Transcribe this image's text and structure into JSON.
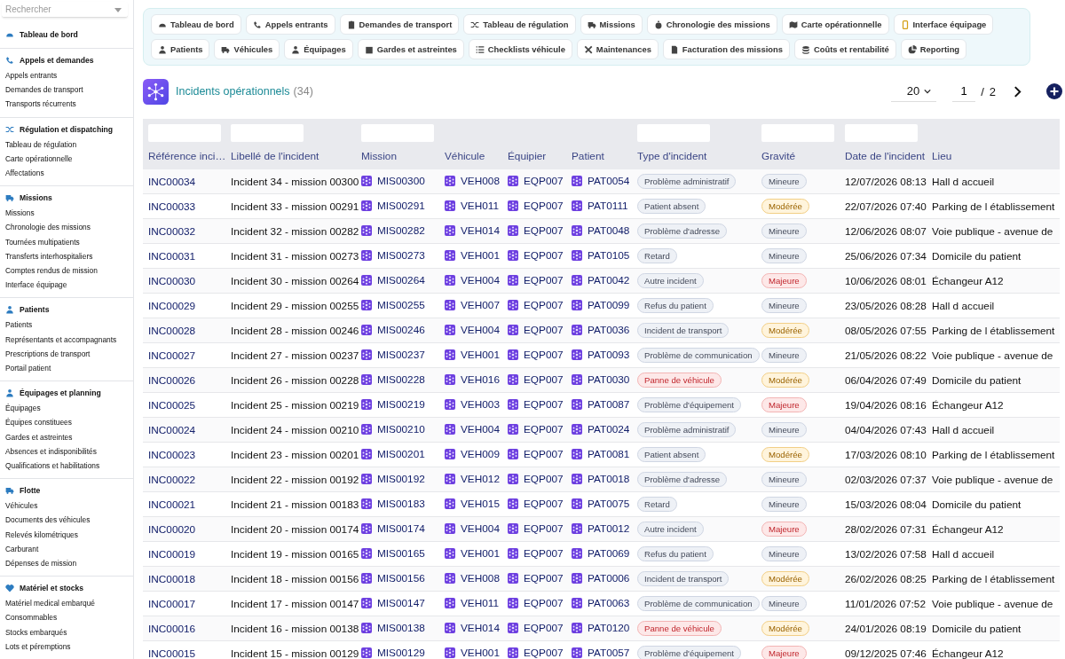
{
  "sidebar": {
    "search": {
      "placeholder": "Rechercher"
    },
    "sections": [
      {
        "title": "Tableau de bord"
      },
      {
        "title": "Appels et demandes",
        "items": [
          "Appels entrants",
          "Demandes de transport",
          "Transports récurrents"
        ]
      },
      {
        "title": "Régulation et dispatching",
        "items": [
          "Tableau de régulation",
          "Carte opérationnelle",
          "Affectations"
        ]
      },
      {
        "title": "Missions",
        "items": [
          "Missions",
          "Chronologie des missions",
          "Tournées multipatients",
          "Transferts interhospitaliers",
          "Comptes rendus de mission",
          "Interface équipage"
        ]
      },
      {
        "title": "Patients",
        "items": [
          "Patients",
          "Représentants et accompagnants",
          "Prescriptions de transport",
          "Portail patient"
        ]
      },
      {
        "title": "Équipages et planning",
        "items": [
          "Équipages",
          "Équipes constituees",
          "Gardes et astreintes",
          "Absences et indisponibilités",
          "Qualifications et habilitations"
        ]
      },
      {
        "title": "Flotte",
        "items": [
          "Véhicules",
          "Documents des véhicules",
          "Relevés kilométriques",
          "Carburant",
          "Dépenses de mission"
        ]
      },
      {
        "title": "Matériel et stocks",
        "items": [
          "Matériel medical embarqué",
          "Consommables",
          "Stocks embarqués",
          "Lots et péremptions"
        ]
      }
    ]
  },
  "nav_tabs": [
    {
      "label": "Tableau de bord"
    },
    {
      "label": "Appels entrants"
    },
    {
      "label": "Demandes de transport"
    },
    {
      "label": "Tableau de régulation"
    },
    {
      "label": "Missions"
    },
    {
      "label": "Chronologie des missions"
    },
    {
      "label": "Carte opérationnelle"
    },
    {
      "label": "Interface équipage"
    },
    {
      "label": "Patients"
    },
    {
      "label": "Véhicules"
    },
    {
      "label": "Équipages"
    },
    {
      "label": "Gardes et astreintes"
    },
    {
      "label": "Checklists véhicule"
    },
    {
      "label": "Maintenances"
    },
    {
      "label": "Facturation des missions"
    },
    {
      "label": "Coûts et rentabilité"
    },
    {
      "label": "Reporting"
    }
  ],
  "page": {
    "title": "Incidents opérationnels",
    "count": "(34)",
    "page_size": "20",
    "page": "1",
    "separator": "/",
    "total_pages": "2"
  },
  "table": {
    "columns": [
      {
        "label": "Référence inci…",
        "filter": true
      },
      {
        "label": "Libellé de l'incident",
        "filter": true
      },
      {
        "label": "Mission",
        "filter": true
      },
      {
        "label": "Véhicule",
        "filter": false
      },
      {
        "label": "Équipier",
        "filter": false
      },
      {
        "label": "Patient",
        "filter": false
      },
      {
        "label": "Type d'incident",
        "filter": true
      },
      {
        "label": "Gravité",
        "filter": true
      },
      {
        "label": "Date de l'incident",
        "filter": true
      },
      {
        "label": "Lieu",
        "filter": false
      }
    ],
    "rows": [
      {
        "reference": "INC00034",
        "label": "Incident 34 - mission 00300",
        "mission": "MIS00300",
        "vehicle": "VEH008",
        "crew_member": "EQP007",
        "patient": "PAT0054",
        "type": {
          "label": "Problème administratif",
          "alert": false
        },
        "severity": {
          "label": "Mineure",
          "kind": "minor"
        },
        "date": "12/07/2026 08:13",
        "location": "Hall d accueil"
      },
      {
        "reference": "INC00033",
        "label": "Incident 33 - mission 00291",
        "mission": "MIS00291",
        "vehicle": "VEH011",
        "crew_member": "EQP007",
        "patient": "PAT0111",
        "type": {
          "label": "Patient absent",
          "alert": false
        },
        "severity": {
          "label": "Modérée",
          "kind": "moderate"
        },
        "date": "22/07/2026 07:40",
        "location": "Parking de l établissement"
      },
      {
        "reference": "INC00032",
        "label": "Incident 32 - mission 00282",
        "mission": "MIS00282",
        "vehicle": "VEH014",
        "crew_member": "EQP007",
        "patient": "PAT0048",
        "type": {
          "label": "Problème d'adresse",
          "alert": false
        },
        "severity": {
          "label": "Mineure",
          "kind": "minor"
        },
        "date": "12/06/2026 08:07",
        "location": "Voie publique - avenue de"
      },
      {
        "reference": "INC00031",
        "label": "Incident 31 - mission 00273",
        "mission": "MIS00273",
        "vehicle": "VEH001",
        "crew_member": "EQP007",
        "patient": "PAT0105",
        "type": {
          "label": "Retard",
          "alert": false
        },
        "severity": {
          "label": "Mineure",
          "kind": "minor"
        },
        "date": "25/06/2026 07:34",
        "location": "Domicile du patient"
      },
      {
        "reference": "INC00030",
        "label": "Incident 30 - mission 00264",
        "mission": "MIS00264",
        "vehicle": "VEH004",
        "crew_member": "EQP007",
        "patient": "PAT0042",
        "type": {
          "label": "Autre incident",
          "alert": false
        },
        "severity": {
          "label": "Majeure",
          "kind": "major"
        },
        "date": "10/06/2026 08:01",
        "location": "Échangeur A12"
      },
      {
        "reference": "INC00029",
        "label": "Incident 29 - mission 00255",
        "mission": "MIS00255",
        "vehicle": "VEH007",
        "crew_member": "EQP007",
        "patient": "PAT0099",
        "type": {
          "label": "Refus du patient",
          "alert": false
        },
        "severity": {
          "label": "Mineure",
          "kind": "minor"
        },
        "date": "23/05/2026 08:28",
        "location": "Hall d accueil"
      },
      {
        "reference": "INC00028",
        "label": "Incident 28 - mission 00246",
        "mission": "MIS00246",
        "vehicle": "VEH004",
        "crew_member": "EQP007",
        "patient": "PAT0036",
        "type": {
          "label": "Incident de transport",
          "alert": false
        },
        "severity": {
          "label": "Modérée",
          "kind": "moderate"
        },
        "date": "08/05/2026 07:55",
        "location": "Parking de l établissement"
      },
      {
        "reference": "INC00027",
        "label": "Incident 27 - mission 00237",
        "mission": "MIS00237",
        "vehicle": "VEH001",
        "crew_member": "EQP007",
        "patient": "PAT0093",
        "type": {
          "label": "Problème de communication",
          "alert": false
        },
        "severity": {
          "label": "Mineure",
          "kind": "minor"
        },
        "date": "21/05/2026 08:22",
        "location": "Voie publique - avenue de"
      },
      {
        "reference": "INC00026",
        "label": "Incident 26 - mission 00228",
        "mission": "MIS00228",
        "vehicle": "VEH016",
        "crew_member": "EQP007",
        "patient": "PAT0030",
        "type": {
          "label": "Panne de véhicule",
          "alert": true
        },
        "severity": {
          "label": "Modérée",
          "kind": "moderate"
        },
        "date": "06/04/2026 07:49",
        "location": "Domicile du patient"
      },
      {
        "reference": "INC00025",
        "label": "Incident 25 - mission 00219",
        "mission": "MIS00219",
        "vehicle": "VEH003",
        "crew_member": "EQP007",
        "patient": "PAT0087",
        "type": {
          "label": "Problème d'équipement",
          "alert": false
        },
        "severity": {
          "label": "Majeure",
          "kind": "major"
        },
        "date": "19/04/2026 08:16",
        "location": "Échangeur A12"
      },
      {
        "reference": "INC00024",
        "label": "Incident 24 - mission 00210",
        "mission": "MIS00210",
        "vehicle": "VEH004",
        "crew_member": "EQP007",
        "patient": "PAT0024",
        "type": {
          "label": "Problème administratif",
          "alert": false
        },
        "severity": {
          "label": "Mineure",
          "kind": "minor"
        },
        "date": "04/04/2026 07:43",
        "location": "Hall d accueil"
      },
      {
        "reference": "INC00023",
        "label": "Incident 23 - mission 00201",
        "mission": "MIS00201",
        "vehicle": "VEH009",
        "crew_member": "EQP007",
        "patient": "PAT0081",
        "type": {
          "label": "Patient absent",
          "alert": false
        },
        "severity": {
          "label": "Modérée",
          "kind": "moderate"
        },
        "date": "17/03/2026 08:10",
        "location": "Parking de l établissement"
      },
      {
        "reference": "INC00022",
        "label": "Incident 22 - mission 00192",
        "mission": "MIS00192",
        "vehicle": "VEH012",
        "crew_member": "EQP007",
        "patient": "PAT0018",
        "type": {
          "label": "Problème d'adresse",
          "alert": false
        },
        "severity": {
          "label": "Mineure",
          "kind": "minor"
        },
        "date": "02/03/2026 07:37",
        "location": "Voie publique - avenue de"
      },
      {
        "reference": "INC00021",
        "label": "Incident 21 - mission 00183",
        "mission": "MIS00183",
        "vehicle": "VEH015",
        "crew_member": "EQP007",
        "patient": "PAT0075",
        "type": {
          "label": "Retard",
          "alert": false
        },
        "severity": {
          "label": "Mineure",
          "kind": "minor"
        },
        "date": "15/03/2026 08:04",
        "location": "Domicile du patient"
      },
      {
        "reference": "INC00020",
        "label": "Incident 20 - mission 00174",
        "mission": "MIS00174",
        "vehicle": "VEH004",
        "crew_member": "EQP007",
        "patient": "PAT0012",
        "type": {
          "label": "Autre incident",
          "alert": false
        },
        "severity": {
          "label": "Majeure",
          "kind": "major"
        },
        "date": "28/02/2026 07:31",
        "location": "Échangeur A12"
      },
      {
        "reference": "INC00019",
        "label": "Incident 19 - mission 00165",
        "mission": "MIS00165",
        "vehicle": "VEH001",
        "crew_member": "EQP007",
        "patient": "PAT0069",
        "type": {
          "label": "Refus du patient",
          "alert": false
        },
        "severity": {
          "label": "Mineure",
          "kind": "minor"
        },
        "date": "13/02/2026 07:58",
        "location": "Hall d accueil"
      },
      {
        "reference": "INC00018",
        "label": "Incident 18 - mission 00156",
        "mission": "MIS00156",
        "vehicle": "VEH008",
        "crew_member": "EQP007",
        "patient": "PAT0006",
        "type": {
          "label": "Incident de transport",
          "alert": false
        },
        "severity": {
          "label": "Modérée",
          "kind": "moderate"
        },
        "date": "26/02/2026 08:25",
        "location": "Parking de l établissement"
      },
      {
        "reference": "INC00017",
        "label": "Incident 17 - mission 00147",
        "mission": "MIS00147",
        "vehicle": "VEH011",
        "crew_member": "EQP007",
        "patient": "PAT0063",
        "type": {
          "label": "Problème de communication",
          "alert": false
        },
        "severity": {
          "label": "Mineure",
          "kind": "minor"
        },
        "date": "11/01/2026 07:52",
        "location": "Voie publique - avenue de"
      },
      {
        "reference": "INC00016",
        "label": "Incident 16 - mission 00138",
        "mission": "MIS00138",
        "vehicle": "VEH014",
        "crew_member": "EQP007",
        "patient": "PAT0120",
        "type": {
          "label": "Panne de véhicule",
          "alert": true
        },
        "severity": {
          "label": "Modérée",
          "kind": "moderate"
        },
        "date": "24/01/2026 08:19",
        "location": "Domicile du patient"
      },
      {
        "reference": "INC00015",
        "label": "Incident 15 - mission 00129",
        "mission": "MIS00129",
        "vehicle": "VEH001",
        "crew_member": "EQP007",
        "patient": "PAT0057",
        "type": {
          "label": "Problème d'équipement",
          "alert": false
        },
        "severity": {
          "label": "Majeure",
          "kind": "major"
        },
        "date": "09/12/2025 07:46",
        "location": "Échangeur A12"
      }
    ]
  }
}
